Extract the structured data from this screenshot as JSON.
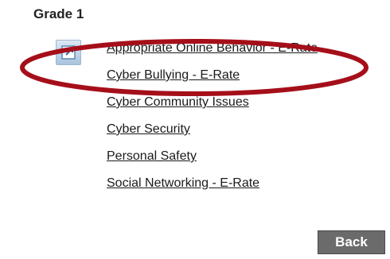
{
  "section": {
    "title": "Grade 1"
  },
  "topics": [
    {
      "label": "Appropriate Online Behavior - E-Rate"
    },
    {
      "label": "Cyber Bullying - E-Rate"
    },
    {
      "label": "Cyber Community Issues"
    },
    {
      "label": "Cyber Security"
    },
    {
      "label": "Personal Safety"
    },
    {
      "label": "Social Networking - E-Rate"
    }
  ],
  "icon": {
    "name": "external-link-icon"
  },
  "highlight": {
    "color": "#a50f1a",
    "target_index": 1
  },
  "back_button": {
    "label": "Back",
    "color": "#6b6b6b"
  }
}
